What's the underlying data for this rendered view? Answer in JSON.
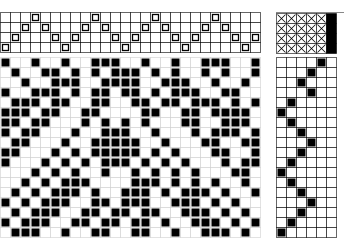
{
  "app": {
    "view": "weave-draft-editor",
    "colors": {
      "grid_line": "#000000",
      "cell_on": "#000000",
      "cell_off": "#ffffff",
      "tieup_x": "#000000",
      "active_treadle": "#000000",
      "scrollbar_bg": "#f0f0f0"
    }
  },
  "scrollbar": {
    "right_arrow": "▸"
  },
  "threading": {
    "cols": 26,
    "rows": 4,
    "pattern": [
      1,
      2,
      3,
      4,
      3,
      2,
      1,
      2,
      3,
      4,
      3,
      2,
      1,
      2,
      3,
      4,
      3,
      2,
      1,
      2,
      3,
      4,
      3,
      2,
      1,
      2
    ]
  },
  "tieup": {
    "cols": 6,
    "rows": 4,
    "marks": [
      [
        1,
        1,
        1,
        1,
        1,
        1
      ],
      [
        1,
        1,
        1,
        1,
        1,
        1
      ],
      [
        1,
        1,
        1,
        1,
        1,
        1
      ],
      [
        1,
        1,
        1,
        1,
        1,
        1
      ]
    ],
    "active_column": 6
  },
  "drawdown": {
    "cols": 26,
    "rows": 18,
    "cells": [
      "10010010011100100100111001",
      "01001101010111010100101001",
      "00100111001111001110010010",
      "10011101011011010111001100",
      "01110110011001101101110101",
      "11101100110000110011011110",
      "11011000101010100011001110",
      "10110001001110010001011101",
      "01100010011111001000110011",
      "11000101011111010100011001",
      "10001010101110101010001011",
      "00010101001001010101000110",
      "00101011100001110101010010",
      "01010111010011101011101001",
      "10101110011011100111010100",
      "01011100110110110011101010",
      "10111001101101101001110101",
      "01110010011001100100111010"
    ]
  },
  "treadling": {
    "cols": 6,
    "rows": 18,
    "pattern": [
      5,
      4,
      3,
      4,
      2,
      1,
      2,
      3,
      4,
      3,
      2,
      1,
      2,
      3,
      4,
      3,
      2,
      1
    ]
  }
}
